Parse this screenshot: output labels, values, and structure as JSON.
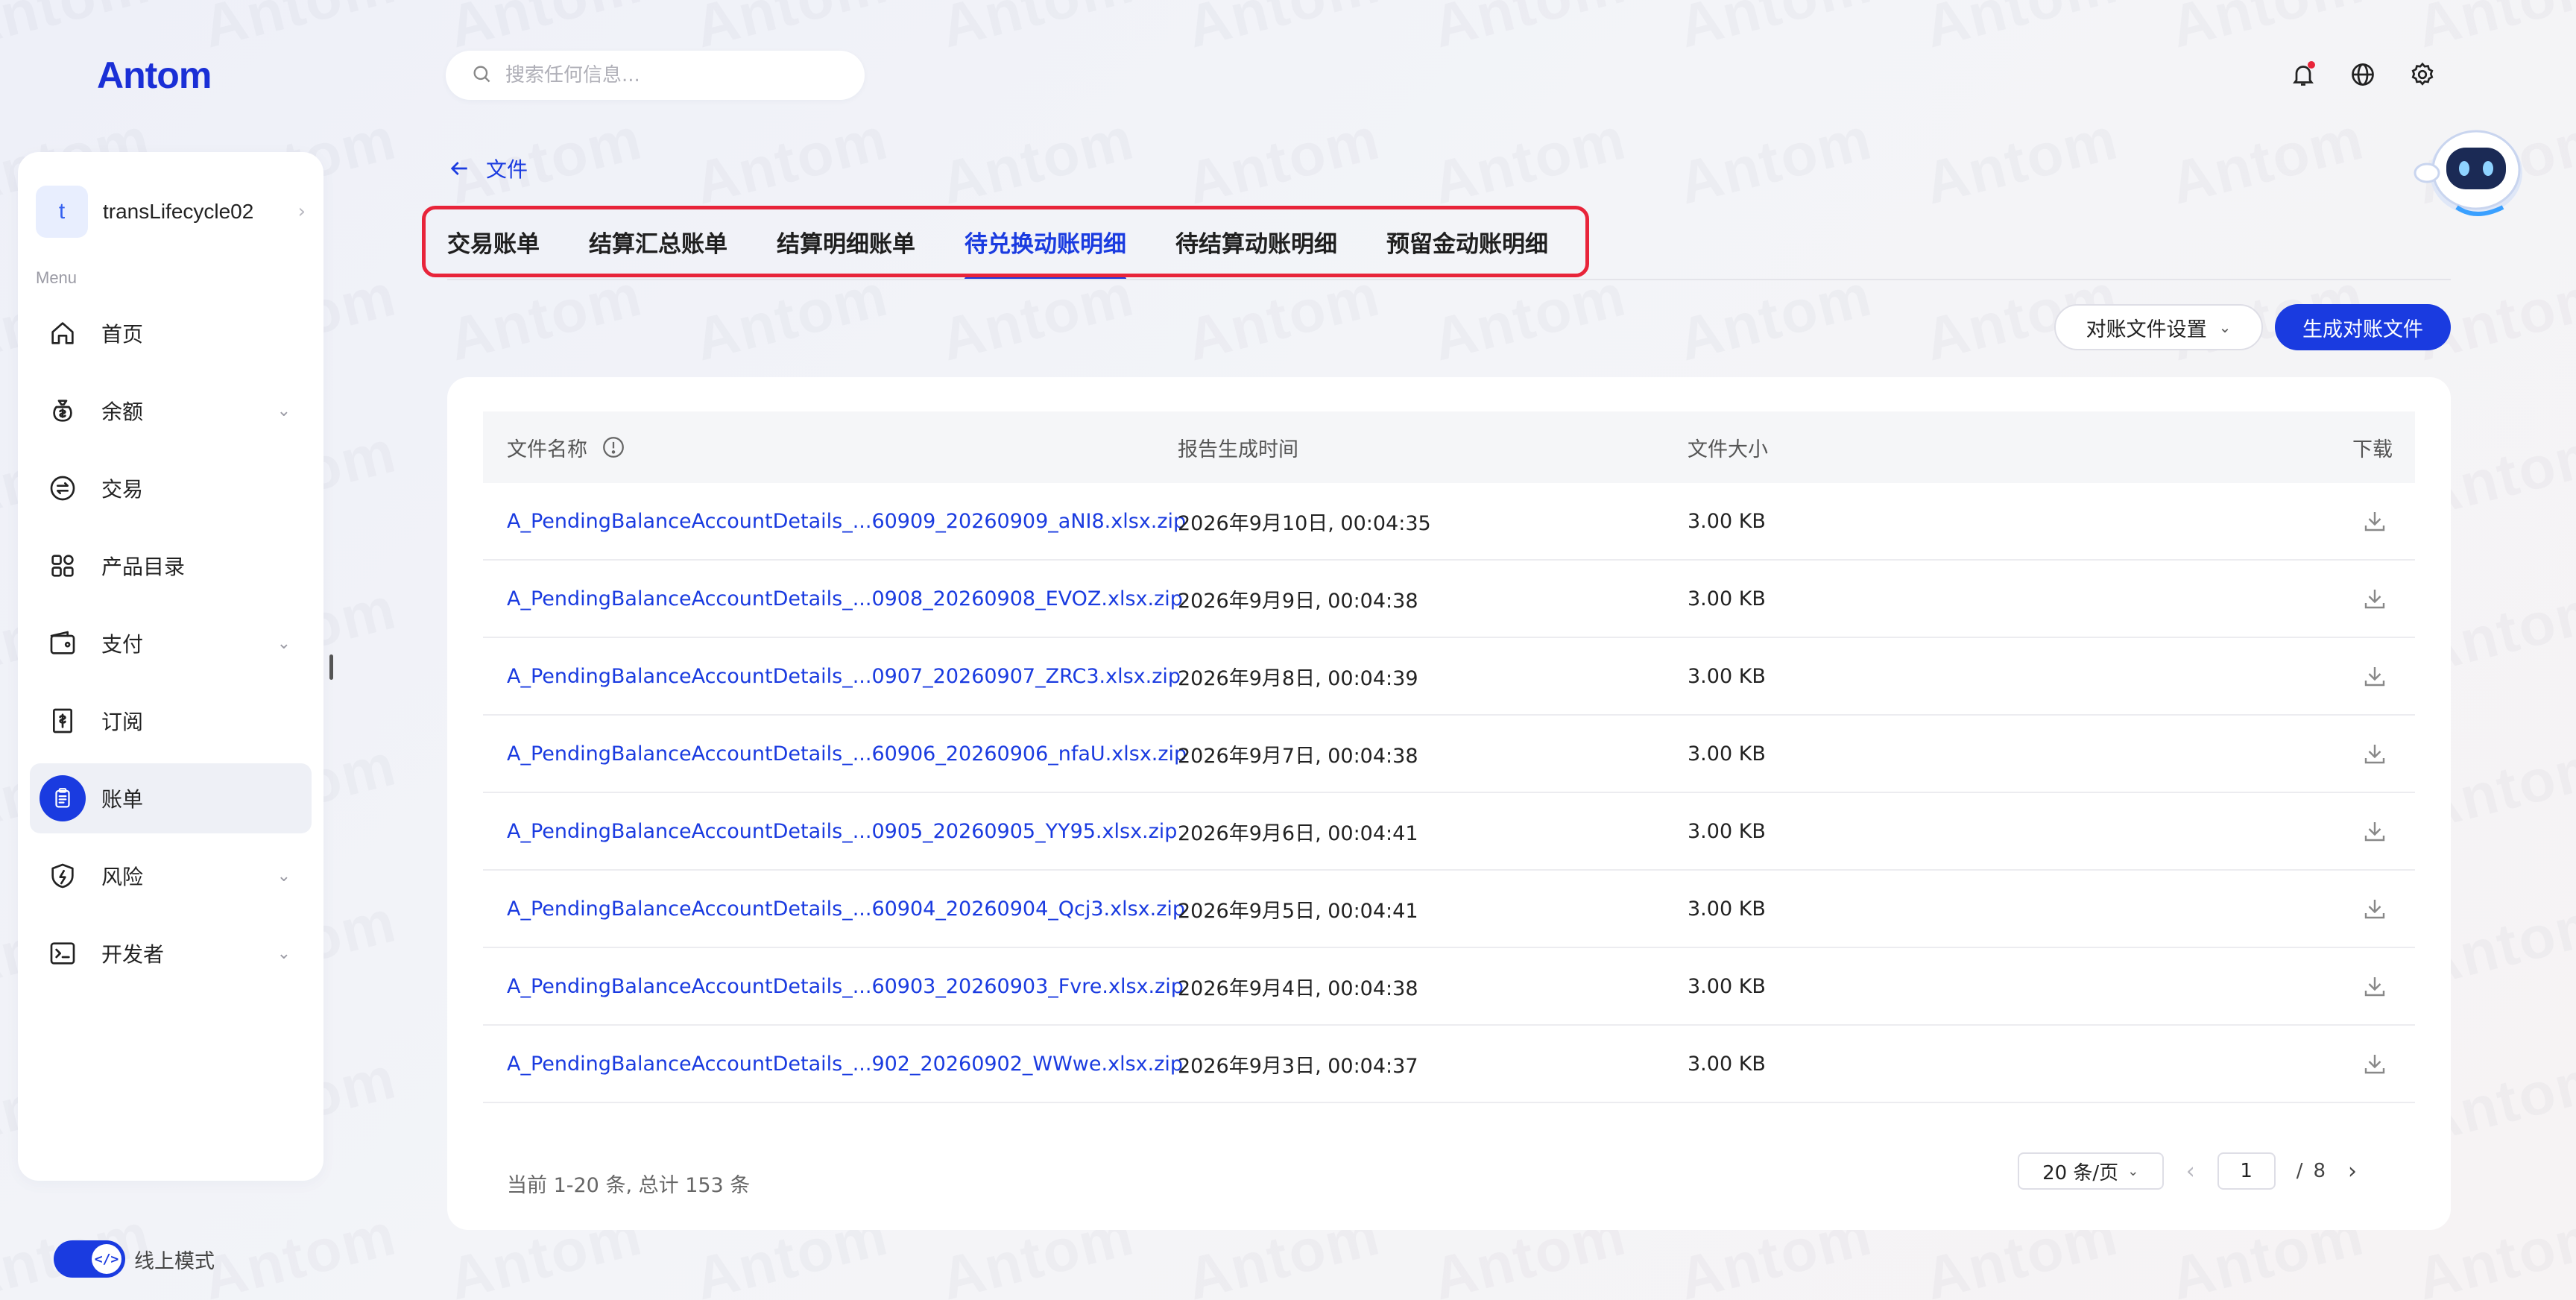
{
  "brand": {
    "logo_text": "Antom",
    "accent": "#1a3be0",
    "highlight_border": "#e8243a",
    "watermark_text": "Antom"
  },
  "sidebar": {
    "merchant": {
      "avatar_letter": "t",
      "name": "transLifecycle02"
    },
    "menu_label": "Menu",
    "items": [
      {
        "label": "首页",
        "icon": "home-icon",
        "has_chevron": false,
        "active": false
      },
      {
        "label": "余额",
        "icon": "money-bag-icon",
        "has_chevron": true,
        "active": false
      },
      {
        "label": "交易",
        "icon": "exchange-icon",
        "has_chevron": false,
        "active": false
      },
      {
        "label": "产品目录",
        "icon": "grid-icon",
        "has_chevron": false,
        "active": false
      },
      {
        "label": "支付",
        "icon": "wallet-icon",
        "has_chevron": true,
        "active": false
      },
      {
        "label": "订阅",
        "icon": "subscription-icon",
        "has_chevron": false,
        "active": false
      },
      {
        "label": "账单",
        "icon": "clipboard-icon",
        "has_chevron": false,
        "active": true
      },
      {
        "label": "风险",
        "icon": "shield-icon",
        "has_chevron": true,
        "active": false
      },
      {
        "label": "开发者",
        "icon": "terminal-icon",
        "has_chevron": true,
        "active": false
      }
    ],
    "mode_toggle": {
      "label": "线上模式",
      "on": true,
      "knob_glyph": "</>"
    }
  },
  "header": {
    "search": {
      "placeholder": "搜索任何信息...",
      "value": ""
    },
    "icons": [
      "bell-icon",
      "globe-icon",
      "gear-icon"
    ]
  },
  "main": {
    "back_label": "文件",
    "tabs": [
      {
        "label": "交易账单",
        "active": false
      },
      {
        "label": "结算汇总账单",
        "active": false
      },
      {
        "label": "结算明细账单",
        "active": false
      },
      {
        "label": "待兑换动账明细",
        "active": true
      },
      {
        "label": "待结算动账明细",
        "active": false
      },
      {
        "label": "预留金动账明细",
        "active": false
      }
    ],
    "buttons": {
      "settings": "对账文件设置",
      "generate": "生成对账文件"
    },
    "table": {
      "columns": {
        "name": "文件名称",
        "time": "报告生成时间",
        "size": "文件大小",
        "download": "下载"
      },
      "rows": [
        {
          "name": "A_PendingBalanceAccountDetails_...60909_20260909_aNI8.xlsx.zip",
          "time": "2026年9月10日, 00:04:35",
          "size": "3.00 KB"
        },
        {
          "name": "A_PendingBalanceAccountDetails_...0908_20260908_EVOZ.xlsx.zip",
          "time": "2026年9月9日, 00:04:38",
          "size": "3.00 KB"
        },
        {
          "name": "A_PendingBalanceAccountDetails_...0907_20260907_ZRC3.xlsx.zip",
          "time": "2026年9月8日, 00:04:39",
          "size": "3.00 KB"
        },
        {
          "name": "A_PendingBalanceAccountDetails_...60906_20260906_nfaU.xlsx.zip",
          "time": "2026年9月7日, 00:04:38",
          "size": "3.00 KB"
        },
        {
          "name": "A_PendingBalanceAccountDetails_...0905_20260905_YY95.xlsx.zip",
          "time": "2026年9月6日, 00:04:41",
          "size": "3.00 KB"
        },
        {
          "name": "A_PendingBalanceAccountDetails_...60904_20260904_Qcj3.xlsx.zip",
          "time": "2026年9月5日, 00:04:41",
          "size": "3.00 KB"
        },
        {
          "name": "A_PendingBalanceAccountDetails_...60903_20260903_Fvre.xlsx.zip",
          "time": "2026年9月4日, 00:04:38",
          "size": "3.00 KB"
        },
        {
          "name": "A_PendingBalanceAccountDetails_...902_20260902_WWwe.xlsx.zip",
          "time": "2026年9月3日, 00:04:37",
          "size": "3.00 KB"
        }
      ]
    },
    "pagination": {
      "summary": "当前 1-20 条, 总计 153 条",
      "page_size": "20 条/页",
      "current_page": "1",
      "separator": "/",
      "total_pages": "8"
    }
  }
}
